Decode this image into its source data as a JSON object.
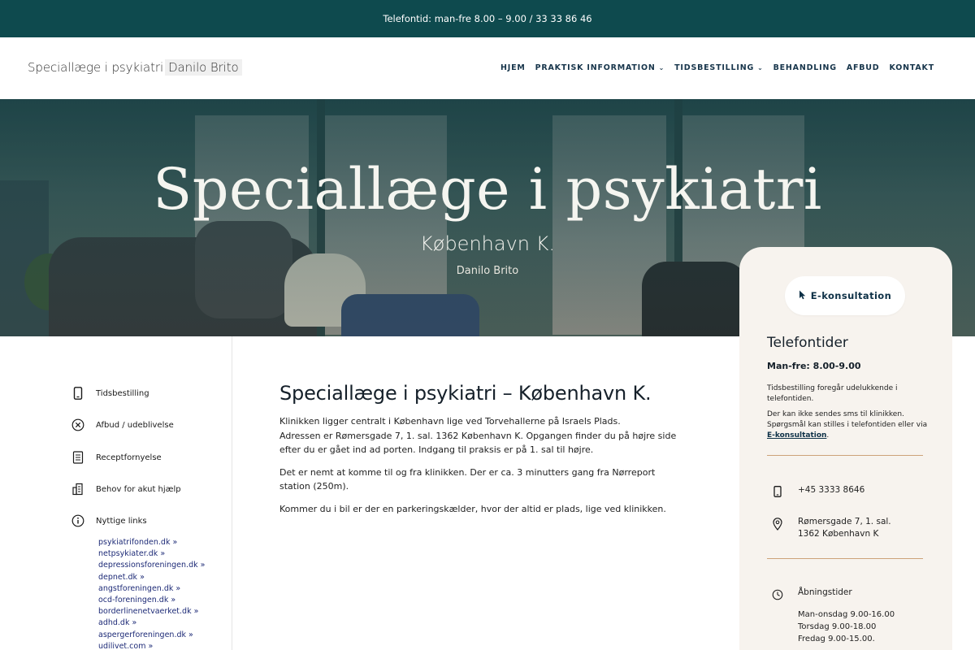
{
  "topbar": {
    "text": "Telefontid: man-fre 8.00 – 9.00 / 33 33 86 46"
  },
  "header": {
    "logo_main": "Speciallæge i psykiatri",
    "logo_name": "Danilo Brito",
    "nav": [
      {
        "label": "HJEM",
        "has_dropdown": false
      },
      {
        "label": "PRAKTISK INFORMATION",
        "has_dropdown": true
      },
      {
        "label": "TIDSBESTILLING",
        "has_dropdown": true
      },
      {
        "label": "BEHANDLING",
        "has_dropdown": false
      },
      {
        "label": "AFBUD",
        "has_dropdown": false
      },
      {
        "label": "KONTAKT",
        "has_dropdown": false
      }
    ]
  },
  "hero": {
    "title": "Speciallæge i psykiatri",
    "subtitle": "København K.",
    "name": "Danilo Brito"
  },
  "sidebar": {
    "items": [
      {
        "label": "Tidsbestilling",
        "icon": "phone-icon"
      },
      {
        "label": "Afbud / udeblivelse",
        "icon": "cancel-circle-icon"
      },
      {
        "label": "Receptfornyelse",
        "icon": "document-icon"
      },
      {
        "label": "Behov for akut hjælp",
        "icon": "building-icon"
      },
      {
        "label": "Nyttige links",
        "icon": "info-icon"
      }
    ],
    "links": [
      "psykiatrifonden.dk »",
      "netpsykiater.dk »",
      "depressionsforeningen.dk »",
      "depnet.dk »",
      "angstforeningen.dk »",
      "ocd-foreningen.dk »",
      "borderlinenetvaerket.dk »",
      "adhd.dk »",
      "aspergerforeningen.dk »",
      "udilivet.com »"
    ]
  },
  "main": {
    "heading": "Speciallæge i psykiatri – København K.",
    "p1_line1": "Klinikken ligger centralt i København lige ved Torvehallerne på Israels Plads.",
    "p1_line2": "Adressen er Rømersgade 7, 1. sal. 1362 København K. Opgangen finder du på højre side efter du er gået ind ad porten. Indgang til praksis er på 1. sal til højre.",
    "p2": "Det er nemt at komme til og fra klinikken. Der er ca. 3 minutters gang fra Nørreport station (250m).",
    "p3": "Kommer du i bil er der en parkeringskælder, hvor der altid er plads, lige ved klinikken."
  },
  "card": {
    "button_label": "E-konsultation",
    "title": "Telefontider",
    "hours": "Man-fre: 8.00-9.00",
    "note1": "Tidsbestilling foregår udelukkende i telefontiden.",
    "note2": "Der kan ikke sendes sms til klinikken. Spørgsmål kan stilles i telefontiden eller via",
    "note2_link": "E-konsultation",
    "note2_end": ".",
    "phone": "+45 3333 8646",
    "address_line1": "Rømersgade 7, 1. sal.",
    "address_line2": "1362 København K",
    "opening_title": "Åbningstider",
    "opening": [
      "Man-onsdag 9.00-16.00",
      "Torsdag 9.00-18.00",
      "Fredag 9.00-15.00."
    ]
  },
  "colors": {
    "topbar": "#0e4a4e",
    "nav_text": "#17354b",
    "accent_rule": "#cda279",
    "card_bg": "#f7f3ee",
    "link": "#1e2b77"
  }
}
